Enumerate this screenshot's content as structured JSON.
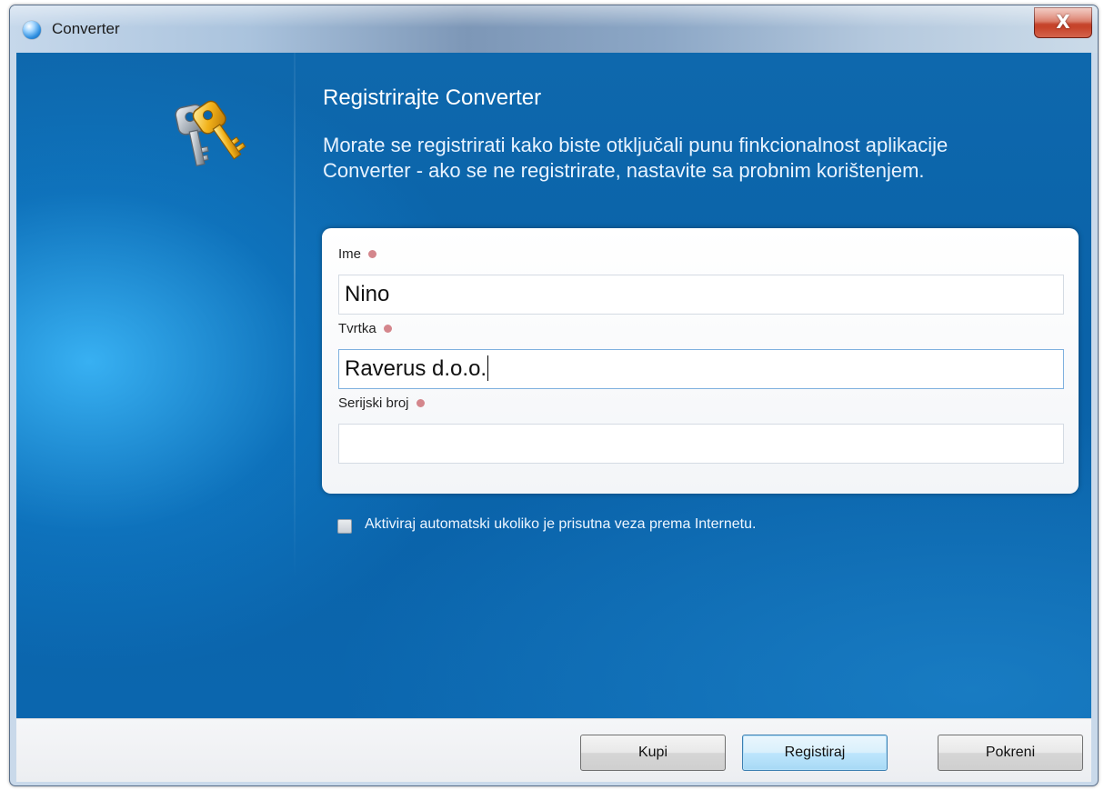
{
  "window": {
    "title": "Converter",
    "close_label": "X"
  },
  "header": {
    "heading": "Registrirajte Converter",
    "description_line1": "Morate se registrirati kako biste otključali punu finkcionalnost aplikacije",
    "description_line2": "Converter - ako se ne registrirate, nastavite sa probnim korištenjem."
  },
  "form": {
    "name": {
      "label": "Ime",
      "value": "Nino"
    },
    "company": {
      "label": "Tvrtka",
      "value": "Raverus d.o.o."
    },
    "serial": {
      "label": "Serijski broj",
      "value": ""
    }
  },
  "auto_activate": {
    "label": "Aktiviraj automatski ukoliko je prisutna veza prema Internetu.",
    "checked": false
  },
  "buttons": {
    "buy": "Kupi",
    "register": "Registiraj",
    "run": "Pokreni"
  },
  "colors": {
    "background": "#0a62a8",
    "required_marker": "#d4868c"
  },
  "icons": {
    "app": "app-globe-icon",
    "keys": "keys-icon"
  }
}
